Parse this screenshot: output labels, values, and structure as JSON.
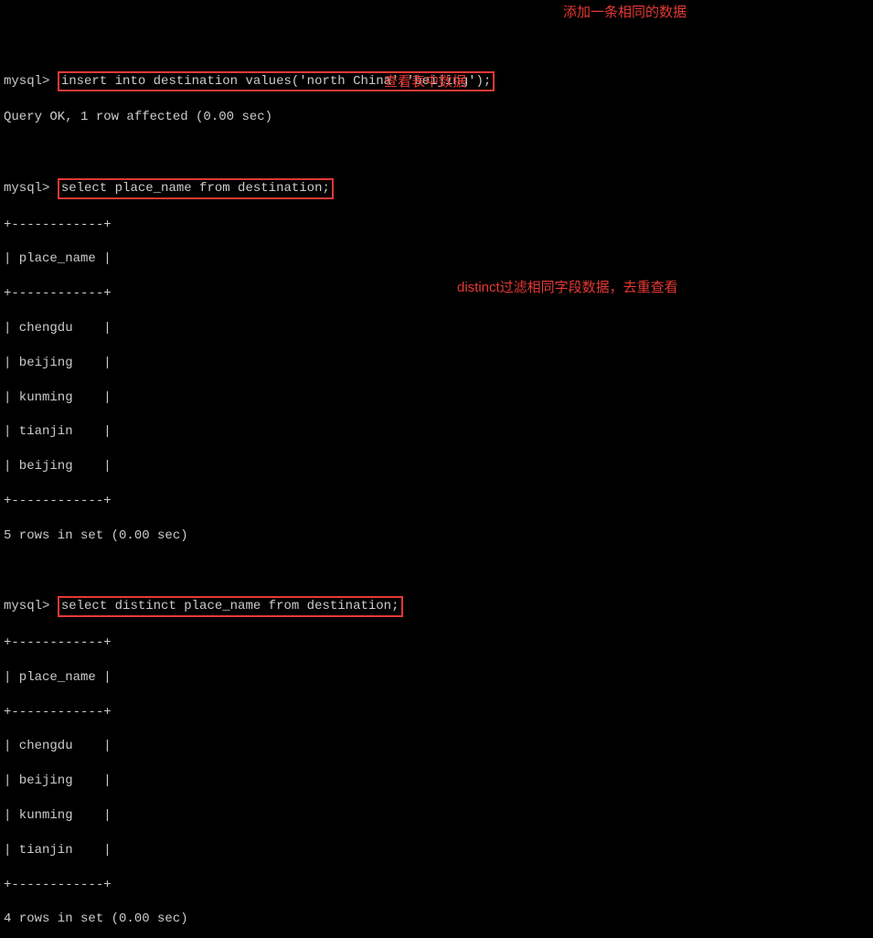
{
  "prompt": "mysql>",
  "block1": {
    "command": "insert into destination values('north China','beijing');",
    "response": "Query OK, 1 row affected (0.00 sec)",
    "annotation": "添加一条相同的数据"
  },
  "block2": {
    "command": "select place_name from destination;",
    "annotation": "查看表中数据",
    "sep": "+------------+",
    "header": "| place_name |",
    "rows": [
      "| chengdu    |",
      "| beijing    |",
      "| kunming    |",
      "| tianjin    |",
      "| beijing    |"
    ],
    "footer": "5 rows in set (0.00 sec)"
  },
  "block3": {
    "command": "select distinct place_name from destination;",
    "annotation": "distinct过滤相同字段数据，去重查看",
    "sep": "+------------+",
    "header": "| place_name |",
    "rows": [
      "| chengdu    |",
      "| beijing    |",
      "| kunming    |",
      "| tianjin    |"
    ],
    "footer": "4 rows in set (0.00 sec)"
  }
}
